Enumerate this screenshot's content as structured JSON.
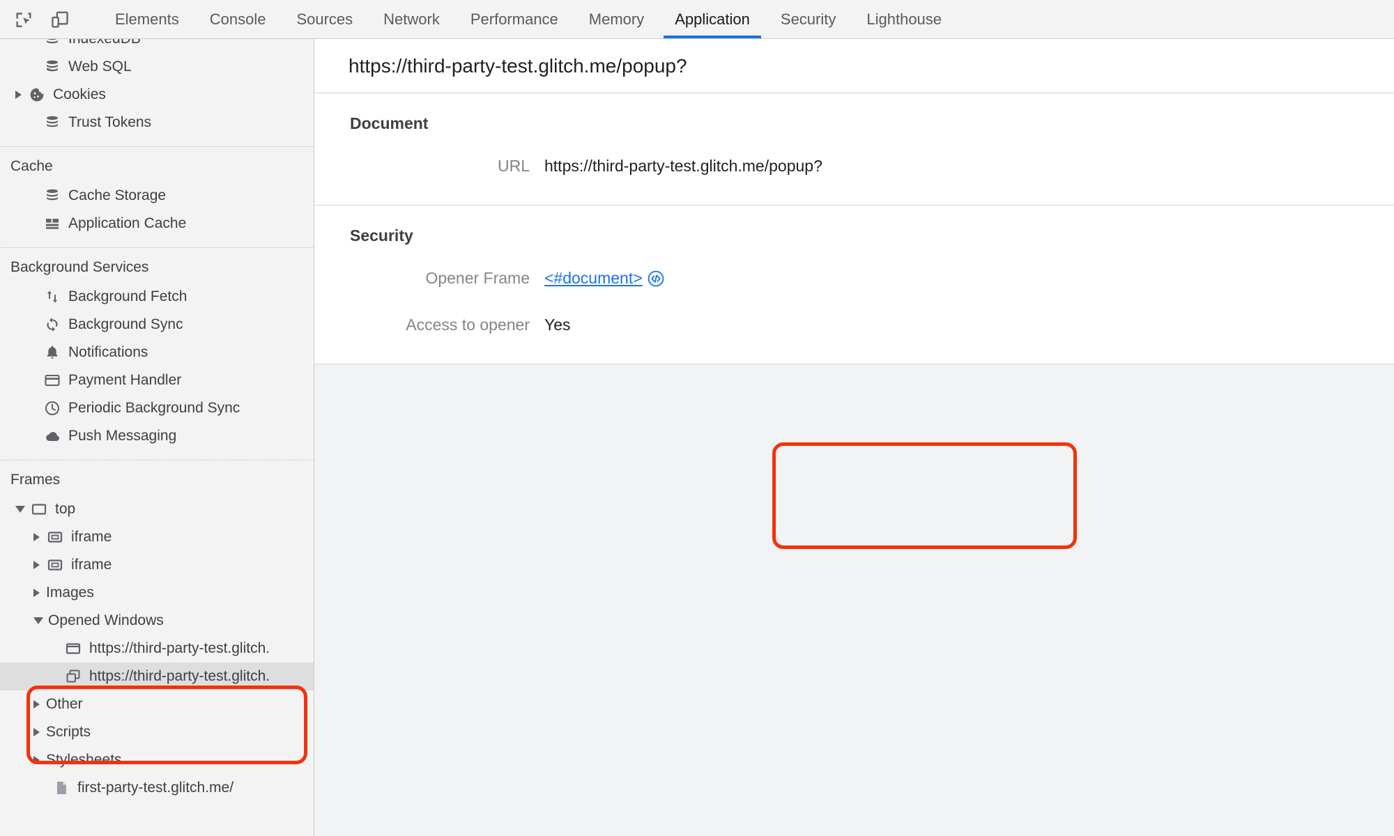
{
  "toolbar": {
    "inspect_icon": "inspect-element-icon",
    "device_icon": "device-toolbar-icon",
    "tabs": [
      {
        "label": "Elements",
        "active": false
      },
      {
        "label": "Console",
        "active": false
      },
      {
        "label": "Sources",
        "active": false
      },
      {
        "label": "Network",
        "active": false
      },
      {
        "label": "Performance",
        "active": false
      },
      {
        "label": "Memory",
        "active": false
      },
      {
        "label": "Application",
        "active": true
      },
      {
        "label": "Security",
        "active": false
      },
      {
        "label": "Lighthouse",
        "active": false
      }
    ],
    "active_tab": "Application",
    "accent_color": "#1a73e8"
  },
  "sidebar": {
    "storage_items": [
      {
        "label": "IndexedDB",
        "icon": "database-icon",
        "clipped": true
      },
      {
        "label": "Web SQL",
        "icon": "database-icon"
      },
      {
        "label": "Cookies",
        "icon": "cookie-icon",
        "expandable": true
      },
      {
        "label": "Trust Tokens",
        "icon": "database-icon"
      }
    ],
    "cache": {
      "title": "Cache",
      "items": [
        {
          "label": "Cache Storage",
          "icon": "database-icon"
        },
        {
          "label": "Application Cache",
          "icon": "grid-icon"
        }
      ]
    },
    "background_services": {
      "title": "Background Services",
      "items": [
        {
          "label": "Background Fetch",
          "icon": "arrows-up-down-icon"
        },
        {
          "label": "Background Sync",
          "icon": "sync-icon"
        },
        {
          "label": "Notifications",
          "icon": "bell-icon"
        },
        {
          "label": "Payment Handler",
          "icon": "credit-card-icon"
        },
        {
          "label": "Periodic Background Sync",
          "icon": "clock-icon"
        },
        {
          "label": "Push Messaging",
          "icon": "cloud-icon"
        }
      ]
    },
    "frames": {
      "title": "Frames",
      "tree": [
        {
          "label": "top",
          "icon": "frame-icon",
          "depth": 1,
          "state": "expanded"
        },
        {
          "label": "iframe",
          "icon": "iframe-icon",
          "depth": 2,
          "state": "collapsed"
        },
        {
          "label": "iframe",
          "icon": "iframe-icon",
          "depth": 2,
          "state": "collapsed"
        },
        {
          "label": "Images",
          "icon": "none",
          "depth": 2,
          "state": "collapsed"
        },
        {
          "label": "Opened Windows",
          "icon": "none",
          "depth": 2,
          "state": "expanded",
          "highlighted": true
        },
        {
          "label": "https://third-party-test.glitch.",
          "icon": "window-icon",
          "depth": 3,
          "state": "leaf"
        },
        {
          "label": "https://third-party-test.glitch.",
          "icon": "windows-stack-icon",
          "depth": 3,
          "state": "leaf",
          "selected": true
        },
        {
          "label": "Other",
          "icon": "none",
          "depth": 2,
          "state": "collapsed"
        },
        {
          "label": "Scripts",
          "icon": "none",
          "depth": 2,
          "state": "collapsed"
        },
        {
          "label": "Stylesheets",
          "icon": "none",
          "depth": 2,
          "state": "collapsed"
        },
        {
          "label": "first-party-test.glitch.me/",
          "icon": "file-icon",
          "depth": 3,
          "state": "leaf"
        }
      ]
    }
  },
  "main": {
    "header_title": "https://third-party-test.glitch.me/popup?",
    "document_section": {
      "title": "Document",
      "rows": [
        {
          "label": "URL",
          "value": "https://third-party-test.glitch.me/popup?"
        }
      ]
    },
    "security_section": {
      "title": "Security",
      "opener_frame_label": "Opener Frame",
      "opener_frame_value": "<#document>",
      "opener_frame_icon": "code-brackets-icon",
      "access_label": "Access to opener",
      "access_value": "Yes"
    }
  },
  "annotations": {
    "color": "#f4310c",
    "boxes": [
      {
        "name": "security-opener-highlight",
        "target": "Opener Frame / Access to opener"
      },
      {
        "name": "opened-windows-highlight",
        "target": "Opened Windows tree node"
      }
    ]
  }
}
